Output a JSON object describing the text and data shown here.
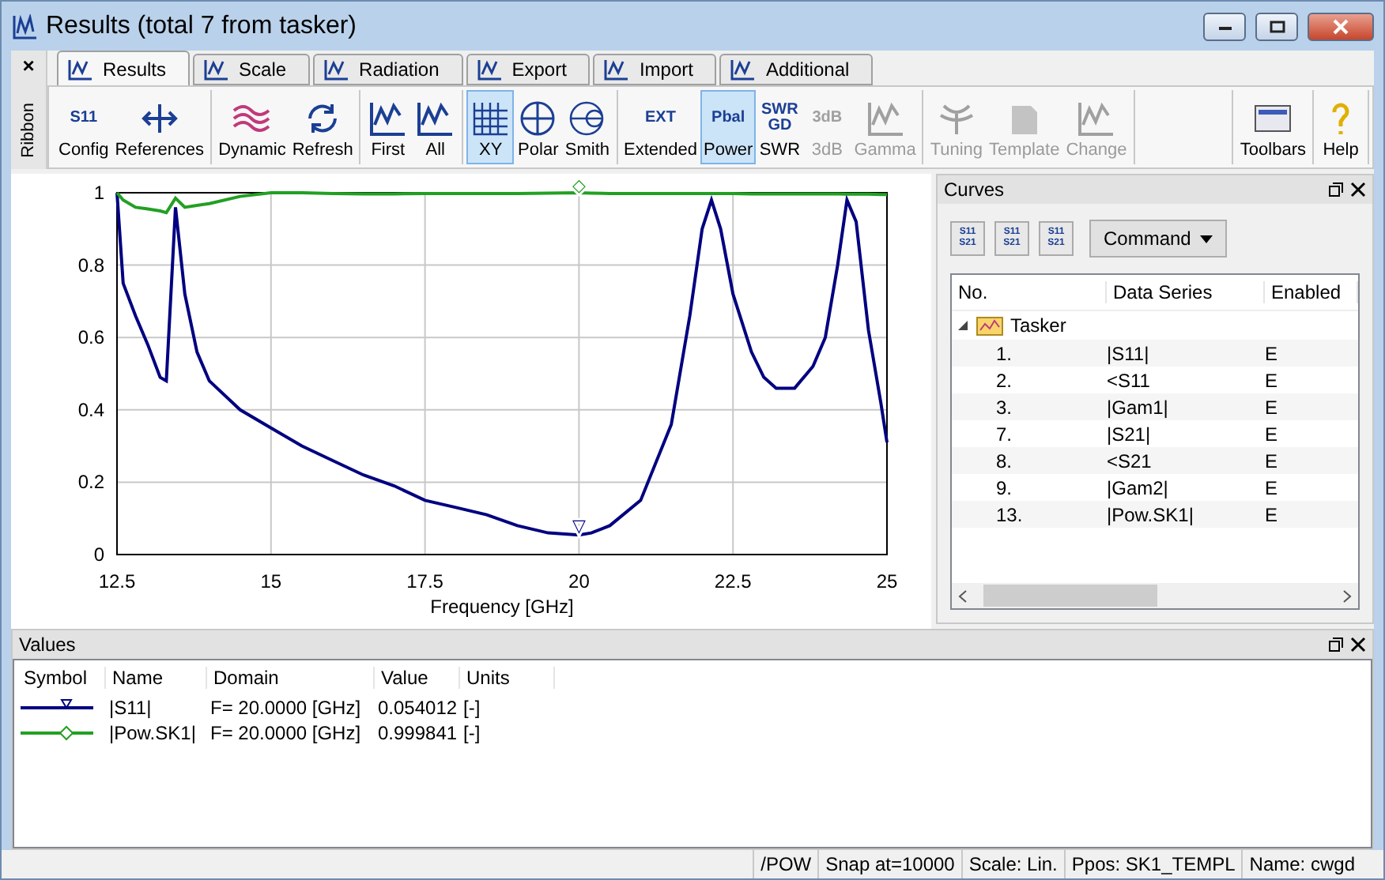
{
  "window": {
    "title": "Results (total 7 from tasker)"
  },
  "ribbon": {
    "label": "Ribbon",
    "close": "×",
    "tabs": [
      {
        "label": "Results",
        "selected": true
      },
      {
        "label": "Scale",
        "selected": false
      },
      {
        "label": "Radiation",
        "selected": false
      },
      {
        "label": "Export",
        "selected": false
      },
      {
        "label": "Import",
        "selected": false
      },
      {
        "label": "Additional",
        "selected": false
      }
    ],
    "groups": [
      {
        "end": false,
        "buttons": [
          {
            "label": "Config",
            "kind": "text",
            "icon_text": "S11",
            "selected": false,
            "disabled": false
          },
          {
            "label": "References",
            "kind": "arrows",
            "selected": false,
            "disabled": false
          }
        ]
      },
      {
        "end": false,
        "buttons": [
          {
            "label": "Dynamic",
            "kind": "wave",
            "selected": false,
            "disabled": false
          },
          {
            "label": "Refresh",
            "kind": "refresh",
            "selected": false,
            "disabled": false
          }
        ]
      },
      {
        "end": false,
        "buttons": [
          {
            "label": "First",
            "kind": "graph",
            "selected": false,
            "disabled": false
          },
          {
            "label": "All",
            "kind": "graph",
            "selected": false,
            "disabled": false
          }
        ]
      },
      {
        "end": false,
        "buttons": [
          {
            "label": "XY",
            "kind": "grid",
            "selected": true,
            "disabled": false
          },
          {
            "label": "Polar",
            "kind": "circle",
            "selected": false,
            "disabled": false
          },
          {
            "label": "Smith",
            "kind": "smith",
            "selected": false,
            "disabled": false
          }
        ]
      },
      {
        "end": false,
        "buttons": [
          {
            "label": "Extended",
            "kind": "text",
            "icon_text": "EXT",
            "selected": false,
            "disabled": false
          },
          {
            "label": "Power",
            "kind": "text",
            "icon_text": "Pbal",
            "selected": true,
            "disabled": false
          },
          {
            "label": "SWR",
            "kind": "text",
            "icon_text": "SWR GD",
            "selected": false,
            "disabled": false
          },
          {
            "label": "3dB",
            "kind": "text",
            "icon_text": "3dB",
            "selected": false,
            "disabled": true
          },
          {
            "label": "Gamma",
            "kind": "graph",
            "selected": false,
            "disabled": true
          }
        ]
      },
      {
        "end": false,
        "buttons": [
          {
            "label": "Tuning",
            "kind": "antenna",
            "selected": false,
            "disabled": true
          },
          {
            "label": "Template",
            "kind": "doc",
            "selected": false,
            "disabled": true
          },
          {
            "label": "Change",
            "kind": "graph",
            "selected": false,
            "disabled": true
          }
        ]
      },
      {
        "end": true,
        "buttons": [
          {
            "label": "Toolbars",
            "kind": "toolbar",
            "selected": false,
            "disabled": false
          }
        ]
      },
      {
        "end": false,
        "buttons": [
          {
            "label": "Help",
            "kind": "help",
            "selected": false,
            "disabled": false
          }
        ]
      }
    ]
  },
  "chart": {
    "chart_data": {
      "type": "line",
      "grid": true,
      "annotations": [
        {
          "x": 20,
          "y": 0.06,
          "text": "▽"
        },
        {
          "x": 20,
          "y": 1.0,
          "text": "◇"
        }
      ],
      "xlabel": "Frequency [GHz]",
      "xlim": [
        12.5,
        25
      ],
      "ylim": [
        0,
        1
      ],
      "xticks": [
        12.5,
        15,
        17.5,
        20,
        22.5,
        25
      ],
      "yticks": [
        0,
        0.2,
        0.4,
        0.6,
        0.8,
        1
      ],
      "x": [
        12.5,
        12.6,
        12.8,
        13.0,
        13.2,
        13.3,
        13.45,
        13.6,
        13.8,
        14,
        14.5,
        15,
        15.5,
        16,
        16.5,
        17,
        17.5,
        18,
        18.5,
        19,
        19.5,
        20,
        20.2,
        20.5,
        21,
        21.5,
        21.8,
        22,
        22.15,
        22.3,
        22.5,
        22.8,
        23,
        23.2,
        23.5,
        23.8,
        24,
        24.2,
        24.35,
        24.5,
        24.7,
        24.9,
        25
      ],
      "series": [
        {
          "color": "#000080",
          "values": [
            1.0,
            0.75,
            0.66,
            0.58,
            0.49,
            0.48,
            0.96,
            0.72,
            0.56,
            0.48,
            0.4,
            0.35,
            0.3,
            0.26,
            0.22,
            0.19,
            0.15,
            0.13,
            0.11,
            0.08,
            0.06,
            0.054,
            0.06,
            0.08,
            0.15,
            0.36,
            0.66,
            0.9,
            0.98,
            0.9,
            0.72,
            0.56,
            0.49,
            0.46,
            0.46,
            0.52,
            0.6,
            0.8,
            0.98,
            0.92,
            0.62,
            0.42,
            0.31
          ]
        },
        {
          "color": "#22a022",
          "values": [
            1.0,
            0.98,
            0.96,
            0.955,
            0.95,
            0.945,
            0.985,
            0.96,
            0.965,
            0.97,
            0.99,
            1.0,
            1.0,
            0.998,
            0.997,
            0.997,
            0.998,
            0.998,
            0.998,
            0.998,
            0.999,
            1.0,
            0.999,
            0.998,
            0.998,
            0.998,
            0.998,
            0.998,
            0.998,
            0.998,
            0.998,
            0.997,
            0.997,
            0.997,
            0.997,
            0.997,
            0.997,
            0.997,
            0.996,
            0.996,
            0.996,
            0.995,
            0.995
          ]
        }
      ]
    }
  },
  "curves": {
    "title": "Curves",
    "tools": [
      {
        "icon_text": "S11 S21"
      },
      {
        "icon_text": "S11 S21"
      },
      {
        "icon_text": "S11 S21"
      }
    ],
    "command": "Command",
    "columns": [
      "No.",
      "Data Series",
      "Enabled"
    ],
    "tree": [
      {
        "label": "Tasker",
        "expanded": true,
        "children": [
          {
            "no": "1.",
            "series": "|S11|",
            "enabled": "E"
          },
          {
            "no": "2.",
            "series": "<S11",
            "enabled": "E"
          },
          {
            "no": "3.",
            "series": "|Gam1|",
            "enabled": "E"
          },
          {
            "no": "7.",
            "series": "|S21|",
            "enabled": "E"
          },
          {
            "no": "8.",
            "series": "<S21",
            "enabled": "E"
          },
          {
            "no": "9.",
            "series": "|Gam2|",
            "enabled": "E"
          },
          {
            "no": "13.",
            "series": "|Pow.SK1|",
            "enabled": "E"
          }
        ]
      }
    ]
  },
  "values": {
    "title": "Values",
    "columns": [
      "Symbol",
      "Name",
      "Domain",
      "Value",
      "Units"
    ],
    "rows": [
      {
        "color": "#000080",
        "kind": "triangle",
        "name": "|S11|",
        "domain": "F= 20.0000 [GHz]",
        "value": "0.054012",
        "units": "[-]"
      },
      {
        "color": "#22a022",
        "kind": "diamond",
        "name": "|Pow.SK1|",
        "domain": "F= 20.0000 [GHz]",
        "value": "0.999841",
        "units": "[-]"
      }
    ]
  },
  "status_bar": [
    "/POW",
    "Snap at=10000",
    "Scale: Lin.",
    "Ppos: SK1_TEMPL",
    "Name: cwgd"
  ]
}
